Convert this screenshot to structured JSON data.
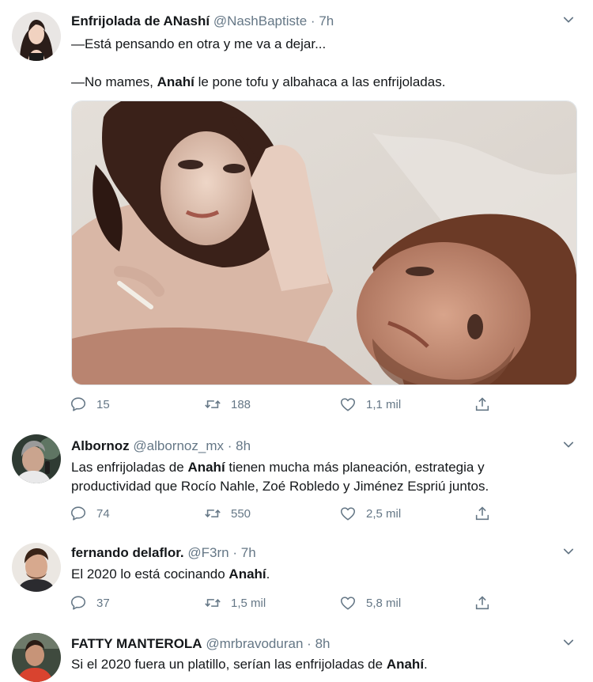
{
  "colors": {
    "text": "#14171a",
    "secondary": "#657786",
    "divider": "#e6ecf0"
  },
  "icons": {
    "reply": "speech-bubble-icon",
    "retweet": "retweet-arrows-icon",
    "like": "heart-outline-icon",
    "share": "share-upload-icon",
    "more": "chevron-down-icon"
  },
  "tweets": [
    {
      "name": "Enfrijolada de ANashí",
      "handle": "@NashBaptiste",
      "dot": "·",
      "time": "7h",
      "line1": "—Está pensando en otra y me va a dejar...",
      "line2_pre": "—No mames, ",
      "line2_bold": "Anahí",
      "line2_post": " le pone tofu y albahaca a las enfrijoladas.",
      "replies": "15",
      "retweets": "188",
      "likes": "1,1 mil"
    },
    {
      "name": "Albornoz",
      "handle": "@albornoz_mx",
      "dot": "·",
      "time": "8h",
      "line1_pre": "Las enfrijoladas de ",
      "line1_bold": "Anahí",
      "line1_post": " tienen mucha más planeación, estrategia y",
      "line2": "productividad que Rocío Nahle, Zoé Robledo y Jiménez Espriú juntos.",
      "replies": "74",
      "retweets": "550",
      "likes": "2,5 mil"
    },
    {
      "name": "fernando delaflor.",
      "handle": "@F3rn",
      "dot": "·",
      "time": "7h",
      "line1_pre": "El 2020 lo está cocinando ",
      "line1_bold": "Anahí",
      "line1_post": ".",
      "replies": "37",
      "retweets": "1,5 mil",
      "likes": "5,8 mil"
    },
    {
      "name": "FATTY MANTEROLA",
      "handle": "@mrbravoduran",
      "dot": "·",
      "time": "8h",
      "line1_pre": "Si el 2020 fuera un platillo, serían las enfrijoladas de ",
      "line1_bold": "Anahí",
      "line1_post": "."
    }
  ]
}
